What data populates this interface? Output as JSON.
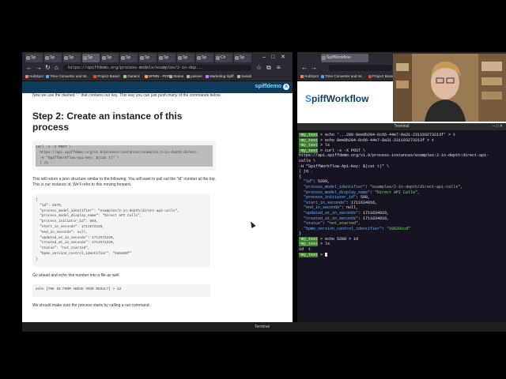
{
  "left_browser": {
    "tabs": [
      "Sp",
      "Sp",
      "Sp",
      "Sp",
      "Sp",
      "Sp",
      "Sp",
      "Sp",
      "Sp",
      "Sp",
      "Ch",
      "Sp"
    ],
    "window_controls": [
      "–",
      "□",
      "✕"
    ],
    "url": "https://spiffdemo.org/process-models/examples/2-in-dep...",
    "bookmarks": [
      "HubSpot",
      "Time Converter and W...",
      "Project Board",
      "Generic",
      "BPMN - PDF",
      "Status",
      "passes",
      "Marketing Spiff",
      "Sanah"
    ],
    "site_logo": "spiffdemo",
    "user_initial": "A",
    "doc": {
      "intro": "Now we use the dashed \"-\" that contains our key. This way you can just push many of the commands below.",
      "heading": "Step 2: Create an instance of this process",
      "code1": "curl -s -X POST \\\n  https://api.spiffdemo.org/v1.0/process-instances/examples:2-in-depth:direct-\n  -H \"SpiffWorkflow-Api-Key: $(cat t)\" \\\n  | jq .",
      "para2": "This will return a json structure similar to the following. You will want to pull out the \"id\" number at the top. This is our instance id. We'll refer to this moving forward.",
      "json_lines": [
        "{",
        "  \"id\": 5279,",
        "  \"process_model_identifier\": \"examples/2-in-depth/direct-api-calls\",",
        "  \"process_model_display_name\": \"Direct API Calls\",",
        "  \"process_initiator_id\": 503,",
        "  \"start_in_seconds\": 1711572220,",
        "  \"end_in_seconds\": null,",
        "  \"updated_at_in_seconds\": 1711572220,",
        "  \"created_at_in_seconds\": 1711572220,",
        "  \"status\": \"not_started\",",
        "  \"bpmn_version_control_identifier\": \"8a6a89f\"",
        "}"
      ],
      "para3": "Go ahead and echo this number into a file as well.",
      "code2": "echo [THE ID FROM ABOVE YOUR RESULT] > id",
      "para4": "We should make sure the process starts by calling a run command."
    }
  },
  "right_browser": {
    "tab": "SpiffWorkflow",
    "bookmarks": [
      "HubSpot",
      "Time Converter and W...",
      "Project Board"
    ],
    "logo_s": "S",
    "logo_text": "piffWorkflow"
  },
  "terminal": {
    "title": "Terminal",
    "prompt": "~my_test",
    "lines": [
      {
        "p": true,
        "t": " > echo '...280-8ee8b204-6c66-44e7-8a31-231193273213f' > t"
      },
      {
        "p": true,
        "t": " > echo 8ee8b204-6c66-44e7-8a31-231193273213f > t"
      },
      {
        "p": true,
        "t": " > ls"
      },
      {
        "p": false,
        "t": ""
      },
      {
        "p": true,
        "t": " > curl -s -X POST \\"
      },
      {
        "p": false,
        "t": "https://api.spiffdemo.org/v1.0/process-instances/examples:2-in-depth:direct-api-"
      },
      {
        "p": false,
        "t": "calls \\"
      },
      {
        "p": false,
        "t": "-H \"SpiffWorkflow-Api-Key: $(cat t)\" \\"
      },
      {
        "p": false,
        "t": "| jq ."
      },
      {
        "p": false,
        "t": "{"
      },
      {
        "p": false,
        "t": "  \"id\": 5289,"
      },
      {
        "p": false,
        "t": "  \"process_model_identifier\": \"examples/2-in-depth/direct-api-calls\","
      },
      {
        "p": false,
        "t": "  \"process_model_display_name\": \"Direct API Calls\","
      },
      {
        "p": false,
        "t": "  \"process_initiator_id\": 598,"
      },
      {
        "p": false,
        "t": "  \"start_in_seconds\": 1711634816,"
      },
      {
        "p": false,
        "t": "  \"end_in_seconds\": null,"
      },
      {
        "p": false,
        "t": "  \"updated_at_in_seconds\": 1711634816,"
      },
      {
        "p": false,
        "t": "  \"created_at_in_seconds\": 1711634816,"
      },
      {
        "p": false,
        "t": "  \"status\": \"not_started\","
      },
      {
        "p": false,
        "t": "  \"bpmn_version_control_identifier\": \"10629icd\""
      },
      {
        "p": false,
        "t": "}"
      },
      {
        "p": true,
        "t": " > echo 5289 > id"
      },
      {
        "p": true,
        "t": " > ls"
      },
      {
        "p": false,
        "t": "id  t"
      },
      {
        "p": true,
        "t": " > "
      }
    ]
  },
  "taskbar": {
    "left_label": "",
    "center_label": "Terminal"
  },
  "colors": {
    "site_header": "#0e3c5a",
    "terminal_bg": "#171421",
    "prompt_bg": "#3d7f2e",
    "json_key": "#6fb3ff",
    "json_string": "#7ee07e"
  }
}
